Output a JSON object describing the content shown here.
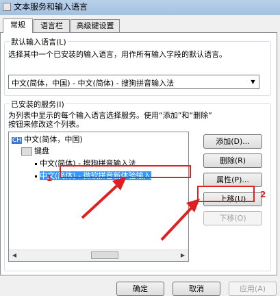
{
  "window": {
    "title": "文本服务和输入语言"
  },
  "tabs": [
    {
      "label": "常规",
      "active": true
    },
    {
      "label": "语言栏",
      "active": false
    },
    {
      "label": "高级键设置",
      "active": false
    }
  ],
  "default_language": {
    "group_title": "默认输入语言(L)",
    "description": "选择其中一个已安装的输入语言，用作所有输入字段的默认语言。",
    "selected": "中文(简体，中国) - 中文(简体) - 搜狗拼音输入法"
  },
  "installed_services": {
    "group_title": "已安装的服务(I)",
    "description_line1": "为列表中显示的每个输入语言选择服务。使用“添加”和“删除”",
    "description_line2": "按钮来修改这个列表。",
    "tree": {
      "language_badge": "CH",
      "language": "中文(简体，中国)",
      "category": "键盘",
      "items": [
        "中文(简体) - 搜狗拼音输入法",
        "中文(简体) - 微软拼音新体验输入"
      ]
    },
    "buttons": {
      "add": "添加(D)...",
      "remove": "删除(R)",
      "properties": "属性(P)...",
      "move_up": "上移(U)",
      "move_down": "下移(O)"
    }
  },
  "annotations": {
    "marker1": "1",
    "marker2": "2",
    "color": "#e02020"
  },
  "footer": {
    "ok": "确定",
    "cancel": "取消",
    "apply": "应用(A)"
  }
}
